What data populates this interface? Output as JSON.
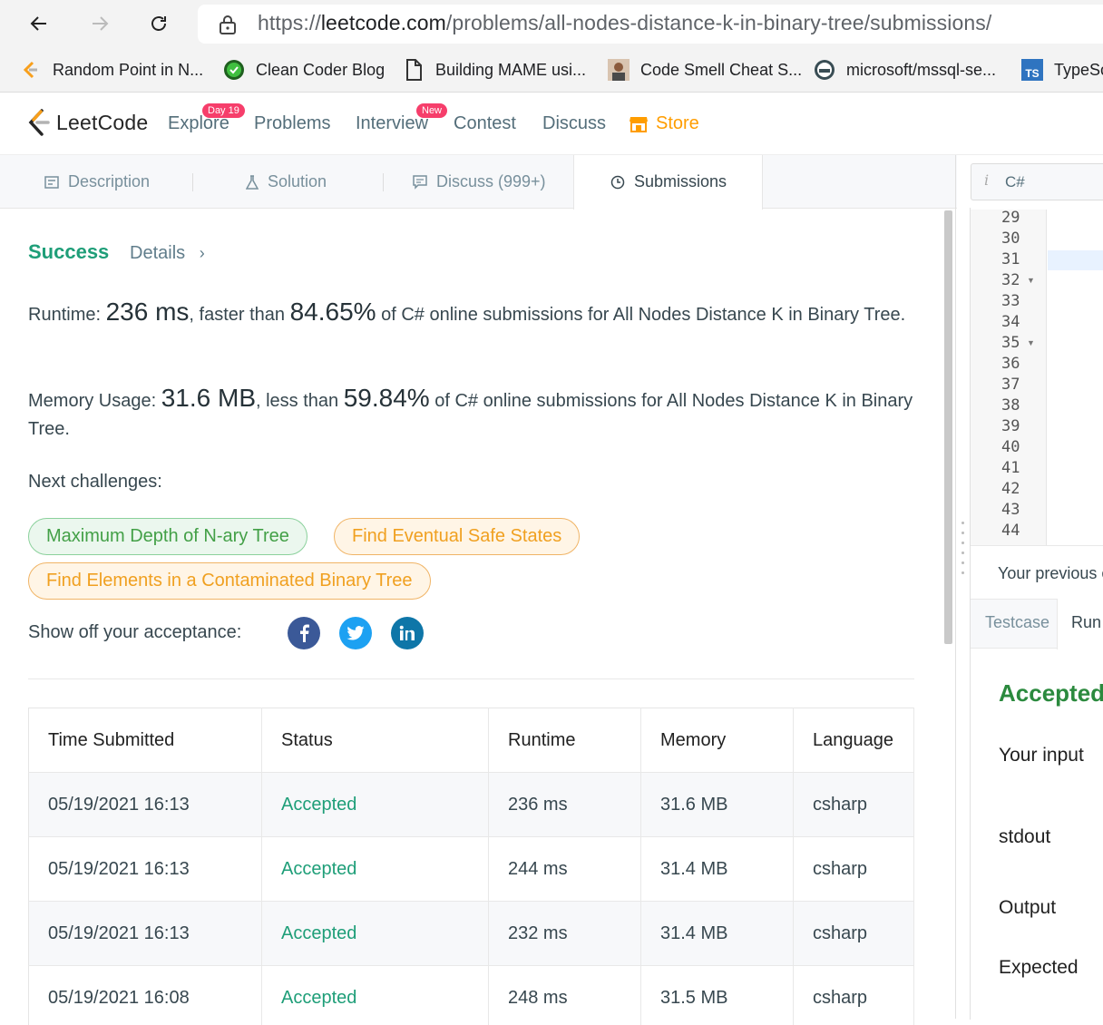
{
  "browser": {
    "url_prefix": "https://",
    "url_host": "leetcode.com",
    "url_path": "/problems/all-nodes-distance-k-in-binary-tree/submissions/",
    "bookmarks": [
      {
        "label": "Random Point in N...",
        "icon": "leetcode-icon"
      },
      {
        "label": "Clean Coder Blog",
        "icon": "green-ball-icon"
      },
      {
        "label": "Building MAME usi...",
        "icon": "document-icon"
      },
      {
        "label": "Code Smell Cheat S...",
        "icon": "avatar-icon"
      },
      {
        "label": "microsoft/mssql-se...",
        "icon": "docker-icon"
      },
      {
        "label": "TypeSc",
        "icon": "ts-icon",
        "icon_text": "TS"
      }
    ]
  },
  "nav": {
    "brand": "LeetCode",
    "links": [
      "Explore",
      "Problems",
      "Interview",
      "Contest",
      "Discuss",
      "Store"
    ],
    "explore_badge": "Day 19",
    "interview_badge": "New"
  },
  "tabs": {
    "description": "Description",
    "solution": "Solution",
    "discuss": "Discuss (999+)",
    "submissions": "Submissions"
  },
  "result": {
    "status": "Success",
    "details": "Details",
    "runtime_label": "Runtime: ",
    "runtime_value": "236 ms",
    "runtime_mid": ", faster than ",
    "runtime_pct": "84.65%",
    "runtime_tail": " of C# online submissions for All Nodes Distance K in Binary Tree.",
    "memory_label": "Memory Usage: ",
    "memory_value": "31.6 MB",
    "memory_mid": ", less than ",
    "memory_pct": "59.84%",
    "memory_tail": " of C# online submissions for All Nodes Distance K in Binary Tree.",
    "next_label": "Next challenges:",
    "challenges": [
      {
        "label": "Maximum Depth of N-ary Tree",
        "difficulty": "easy"
      },
      {
        "label": "Find Eventual Safe States",
        "difficulty": "medium"
      },
      {
        "label": "Find Elements in a Contaminated Binary Tree",
        "difficulty": "medium"
      }
    ],
    "share_label": "Show off your acceptance:",
    "share_icons": [
      "facebook-icon",
      "twitter-icon",
      "linkedin-icon"
    ]
  },
  "table": {
    "headers": [
      "Time Submitted",
      "Status",
      "Runtime",
      "Memory",
      "Language"
    ],
    "rows": [
      [
        "05/19/2021 16:13",
        "Accepted",
        "236 ms",
        "31.6 MB",
        "csharp"
      ],
      [
        "05/19/2021 16:13",
        "Accepted",
        "244 ms",
        "31.4 MB",
        "csharp"
      ],
      [
        "05/19/2021 16:13",
        "Accepted",
        "232 ms",
        "31.4 MB",
        "csharp"
      ],
      [
        "05/19/2021 16:08",
        "Accepted",
        "248 ms",
        "31.5 MB",
        "csharp"
      ]
    ]
  },
  "editor": {
    "language": "C#",
    "line_numbers": [
      "29",
      "30",
      "31",
      "32",
      "33",
      "34",
      "35",
      "36",
      "37",
      "38",
      "39",
      "40",
      "41",
      "42",
      "43",
      "44"
    ],
    "previous_text": "Your previous c",
    "testcase_tab": "Testcase",
    "run_tab": "Run",
    "run_status": "Accepted",
    "labels": [
      "Your input",
      "stdout",
      "Output",
      "Expected"
    ]
  },
  "colors": {
    "accent_green": "#1e9e78",
    "store_orange": "#ff9d00",
    "badge_pink": "#f63e6b"
  }
}
